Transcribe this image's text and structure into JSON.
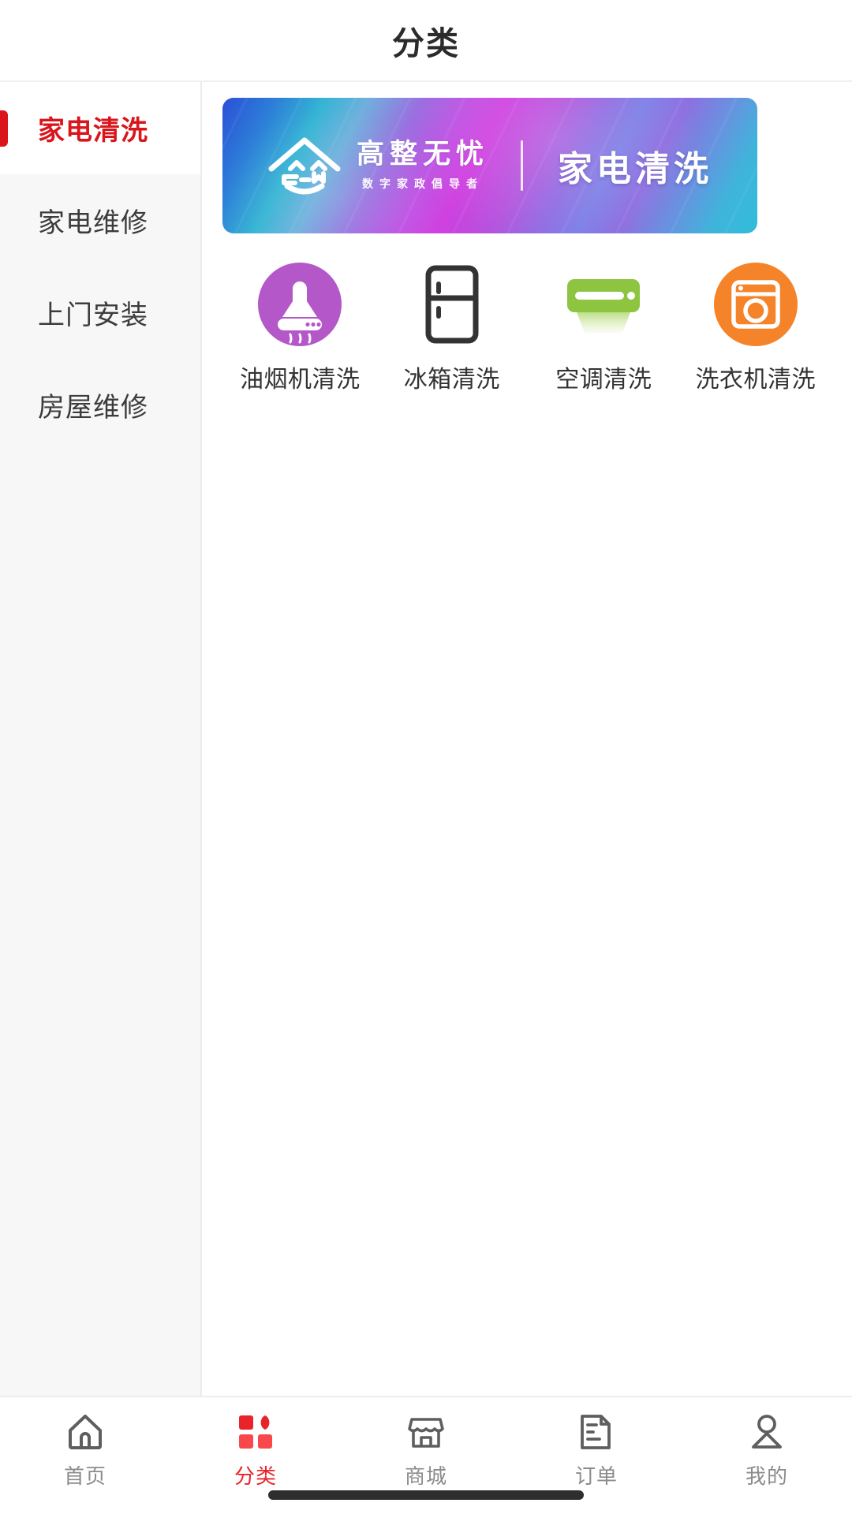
{
  "header": {
    "title": "分类"
  },
  "sidebar": {
    "items": [
      {
        "label": "家电清洗",
        "active": true
      },
      {
        "label": "家电维修",
        "active": false
      },
      {
        "label": "上门安装",
        "active": false
      },
      {
        "label": "房屋维修",
        "active": false
      }
    ]
  },
  "banner": {
    "logo_main": "高整无忧",
    "logo_sub": "数字家政倡导者",
    "headline": "家电清洗",
    "logo_icon": "house-gzw-logo-icon",
    "gradient_colors": [
      "#2b4fd8",
      "#35b5d4",
      "#cf3fe0",
      "#7d7fe6",
      "#31bcd9"
    ]
  },
  "categories": [
    {
      "label": "油烟机清洗",
      "icon": "range-hood-icon",
      "color": "#b457c8"
    },
    {
      "label": "冰箱清洗",
      "icon": "refrigerator-icon",
      "color": "#333333"
    },
    {
      "label": "空调清洗",
      "icon": "air-conditioner-icon",
      "color": "#8dc440"
    },
    {
      "label": "洗衣机清洗",
      "icon": "washing-machine-icon",
      "color": "#f5832a"
    }
  ],
  "tabbar": {
    "items": [
      {
        "label": "首页",
        "icon": "home-icon",
        "active": false
      },
      {
        "label": "分类",
        "icon": "grid-category-icon",
        "active": true
      },
      {
        "label": "商城",
        "icon": "store-icon",
        "active": false
      },
      {
        "label": "订单",
        "icon": "order-document-icon",
        "active": false
      },
      {
        "label": "我的",
        "icon": "user-profile-icon",
        "active": false
      }
    ],
    "active_color": "#e8242a",
    "inactive_color": "#8c8c8c"
  }
}
